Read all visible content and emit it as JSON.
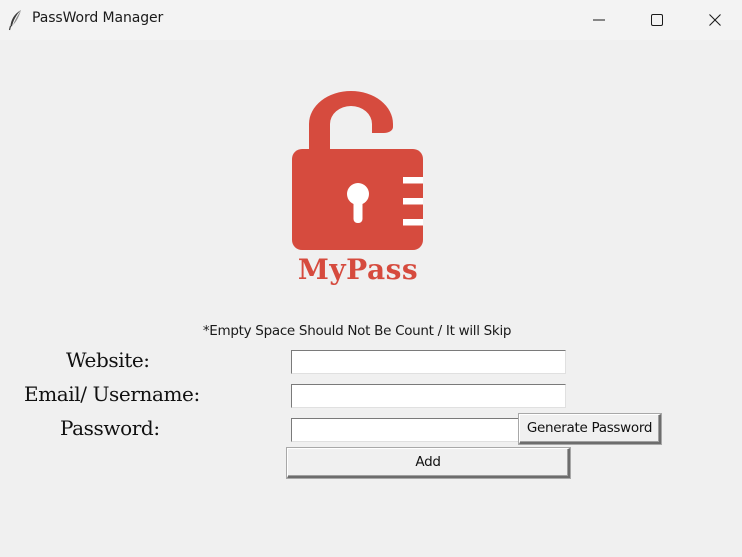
{
  "window": {
    "title": "PassWord Manager",
    "icon": "feather-icon",
    "controls": [
      "minimize-icon",
      "maximize-icon",
      "close-icon"
    ]
  },
  "logo": {
    "text": "MyPass",
    "icon": "open-padlock-icon",
    "color": "#d64b3e"
  },
  "hint": "*Empty Space Should Not Be Count / It will Skip",
  "form": {
    "website_label": "Website:",
    "website_value": "",
    "email_label": "Email/ Username:",
    "email_value": "",
    "password_label": "Password:",
    "password_value": "",
    "generate_label": "Generate Password",
    "add_label": "Add"
  }
}
